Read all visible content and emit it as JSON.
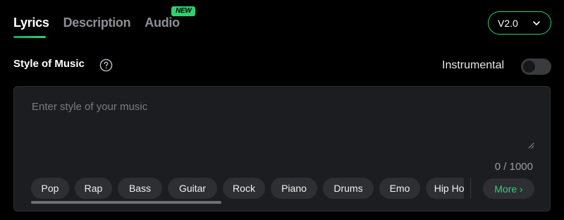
{
  "tabs": [
    {
      "label": "Lyrics",
      "active": true
    },
    {
      "label": "Description",
      "active": false
    },
    {
      "label": "Audio",
      "active": false,
      "badge": "NEW"
    }
  ],
  "version": {
    "label": "V2.0",
    "icon": "chevron-down-icon"
  },
  "style": {
    "title": "Style of Music",
    "help_icon": "question-circle-icon",
    "placeholder": "Enter style of your music",
    "value": "",
    "counter": "0 / 1000"
  },
  "instrumental": {
    "label": "Instrumental",
    "enabled": false
  },
  "chips": [
    "Pop",
    "Rap",
    "Bass",
    "Guitar",
    "Rock",
    "Piano",
    "Drums",
    "Emo",
    "Hip Hop"
  ],
  "more_label": "More ›",
  "colors": {
    "accent": "#2fd16f",
    "background": "#000000",
    "panel": "#1c1d20",
    "chip": "#2e2f33"
  }
}
